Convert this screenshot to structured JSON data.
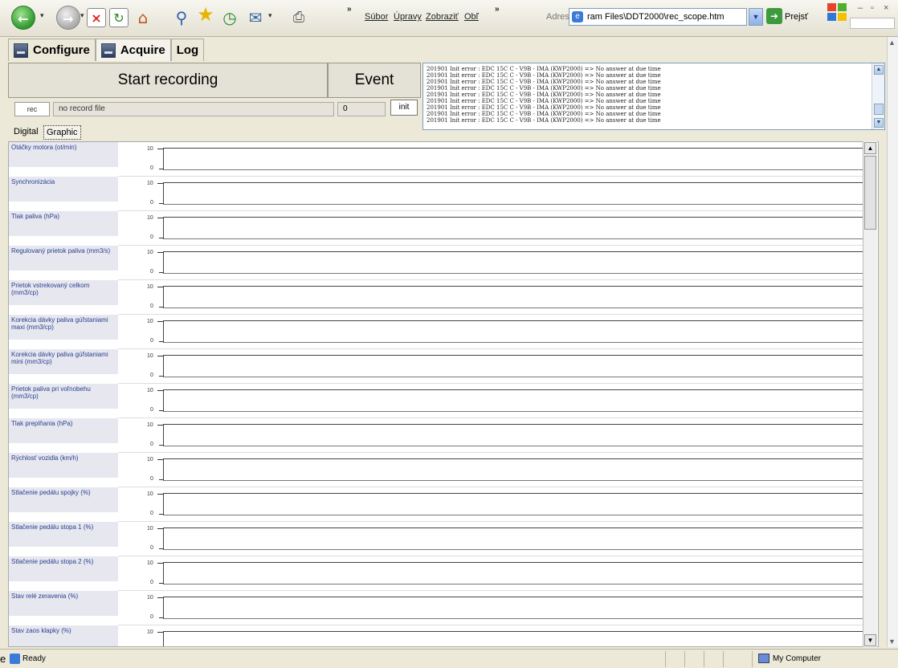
{
  "browser": {
    "menu": [
      "Súbor",
      "Úpravy",
      "Zobraziť",
      "Obľ"
    ],
    "address_label": "Adresa",
    "address": "ram Files\\DDT2000\\rec_scope.htm",
    "go_label": "Prejsť"
  },
  "tabs": [
    {
      "label": "Configure"
    },
    {
      "label": "Acquire"
    },
    {
      "label": "Log"
    }
  ],
  "controls": {
    "start_recording": "Start recording",
    "event": "Event",
    "rec_button": "rec",
    "record_file": "no record file",
    "record_count": "0",
    "init_button": "init"
  },
  "log": {
    "lines": [
      "201901   Init error : EDC 15C C - V9B - IMA (KWP2000) => No answer at due time",
      "201901   Init error : EDC 15C C - V9B - IMA (KWP2000) => No answer at due time",
      "201901   Init error : EDC 15C C - V9B - IMA (KWP2000) => No answer at due time",
      "201901   Init error : EDC 15C C - V9B - IMA (KWP2000) => No answer at due time",
      "201901   Init error : EDC 15C C - V9B - IMA (KWP2000) => No answer at due time",
      "201901   Init error : EDC 15C C - V9B - IMA (KWP2000) => No answer at due time",
      "201901   Init error : EDC 15C C - V9B - IMA (KWP2000) => No answer at due time",
      "201901   Init error : EDC 15C C - V9B - IMA (KWP2000) => No answer at due time",
      "201901   Init error : EDC 15C C - V9B - IMA (KWP2000) => No answer at due time"
    ]
  },
  "subtabs": {
    "digital": "Digital",
    "graphic": "Graphic"
  },
  "graph": {
    "tick_max": "10",
    "tick_min": "0",
    "channels": [
      "Otáčky motora (ot/min)",
      "Synchronizácia",
      "Tlak paliva (hPa)",
      "Regulovaný prietok paliva (mm3/s)",
      "Prietok vstrekovaný celkom (mm3/cp)",
      "Korekcia dávky paliva gúľstaniami maxi (mm3/cp)",
      "Korekcia dávky paliva gúľstaniami mini (mm3/cp)",
      "Prietok paliva pri voľnobehu (mm3/cp)",
      "Tlak preplňania (hPa)",
      "Rýchlosť vozidla (km/h)",
      "Stlačenie pedálu spojky (%)",
      "Stlačenie pedálu stopa 1 (%)",
      "Stlačenie pedálu stopa 2 (%)",
      "Stav relé zeravenia (%)",
      "Stav zaos klapky (%)"
    ]
  },
  "status": {
    "prefix": "e",
    "text": "Ready",
    "zone": "My Computer"
  }
}
